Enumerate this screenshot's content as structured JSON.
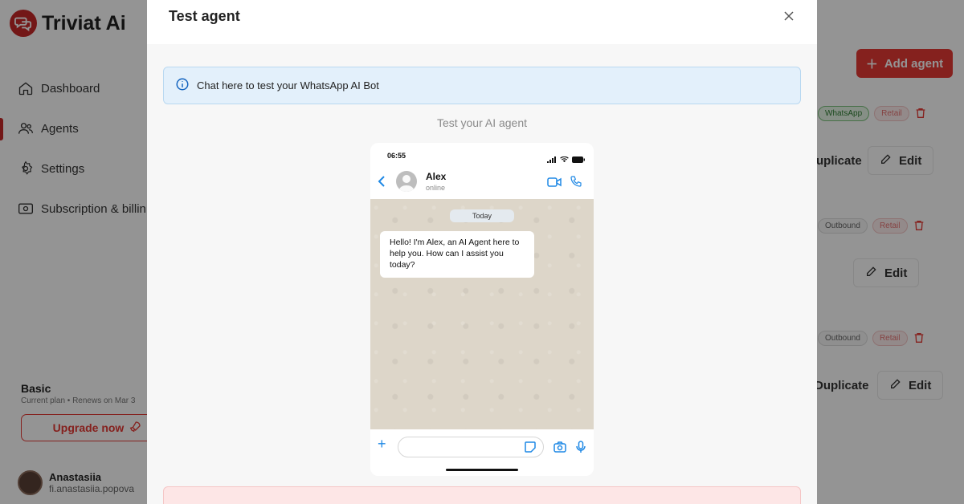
{
  "app": {
    "brand": "Triviat Ai",
    "accent": "#c62828",
    "nav": [
      {
        "label": "Dashboard",
        "icon": "home-icon"
      },
      {
        "label": "Agents",
        "icon": "users-icon",
        "active": true
      },
      {
        "label": "Settings",
        "icon": "gear-icon"
      },
      {
        "label": "Subscription & billin",
        "icon": "billing-icon"
      }
    ],
    "plan": {
      "name": "Basic",
      "subtitle": "Current plan • Renews on Mar 3",
      "upgrade_label": "Upgrade now"
    },
    "user": {
      "name": "Anastasiia",
      "email": "fi.anastasiia.popova"
    },
    "add_agent_label": "Add agent",
    "rows": [
      {
        "channel": "WhatsApp",
        "industry": "Retail",
        "actions": [
          "uplicate",
          "Edit"
        ]
      },
      {
        "channel": "Outbound",
        "industry": "Retail",
        "actions": [
          "Edit"
        ]
      },
      {
        "channel": "Outbound",
        "industry": "Retail",
        "actions": [
          "Duplicate",
          "Edit"
        ]
      }
    ]
  },
  "modal": {
    "title": "Test agent",
    "info_text": "Chat here to test your WhatsApp AI Bot",
    "subtitle": "Test your AI agent",
    "phone": {
      "time": "06:55",
      "contact_name": "Alex",
      "contact_status": "online",
      "date_chip": "Today",
      "message": "Hello! I'm Alex, an AI Agent here to help you. How can I assist you today?"
    }
  }
}
